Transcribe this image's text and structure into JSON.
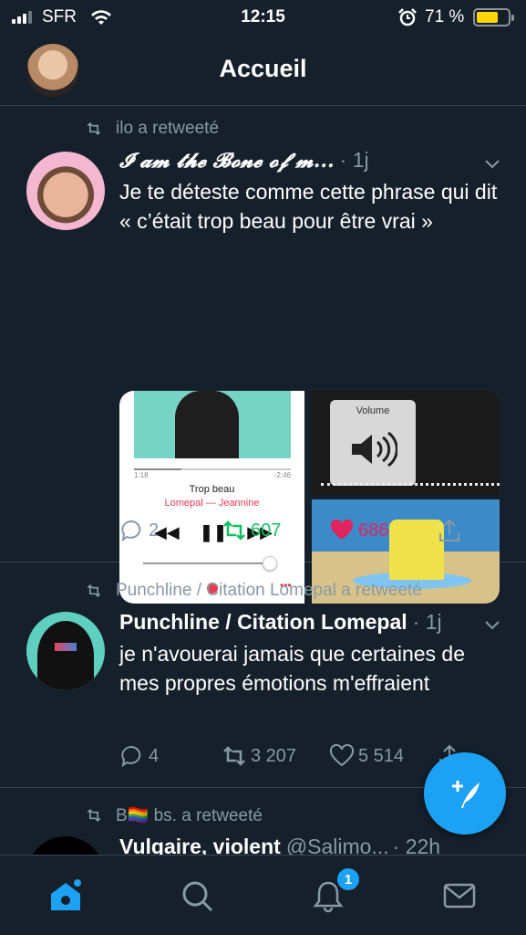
{
  "status_bar": {
    "carrier": "SFR",
    "time": "12:15",
    "battery_pct": "71 %",
    "battery_level": 0.71
  },
  "header": {
    "title": "Accueil"
  },
  "tweets": [
    {
      "retweeted_by": "ilo a retweeté",
      "name": "𝓘 𝓪𝓶 𝓽𝓱𝓮 𝓑𝓸𝓷𝓮 𝓸𝓯 𝓶...",
      "handle": "",
      "time": "· 1j",
      "text": "Je te déteste comme cette phrase qui dit « c’était trop beau pour être vrai »",
      "replies": "2",
      "retweets": "607",
      "likes": "686",
      "retweeted": true,
      "liked": true,
      "media": {
        "time_elapsed": "1:18",
        "time_remaining": "-2:46",
        "song": "Trop beau",
        "artist": "Lomepal — Jeannine",
        "volume_label": "Volume"
      }
    },
    {
      "retweeted_by": "Punchline / Citation Lomepal a retweeté",
      "name": "Punchline / Citation Lomepal",
      "handle": "",
      "time": "· 1j",
      "text": "je n'avouerai jamais que certaines de mes propres émotions m'effraient",
      "replies": "4",
      "retweets": "3 207",
      "likes": "5 514"
    },
    {
      "retweeted_by": "B🏳️‍🌈 bs. a retweeté",
      "name": "Vulgaire, violent",
      "handle": "@Salimo...",
      "time": "· 22h"
    }
  ],
  "tabbar": {
    "notifications_badge": "1"
  },
  "colors": {
    "accent": "#1da1f2",
    "retweet": "#17bf63",
    "like": "#e0245e",
    "background": "#15202b",
    "muted": "#8899a6"
  }
}
